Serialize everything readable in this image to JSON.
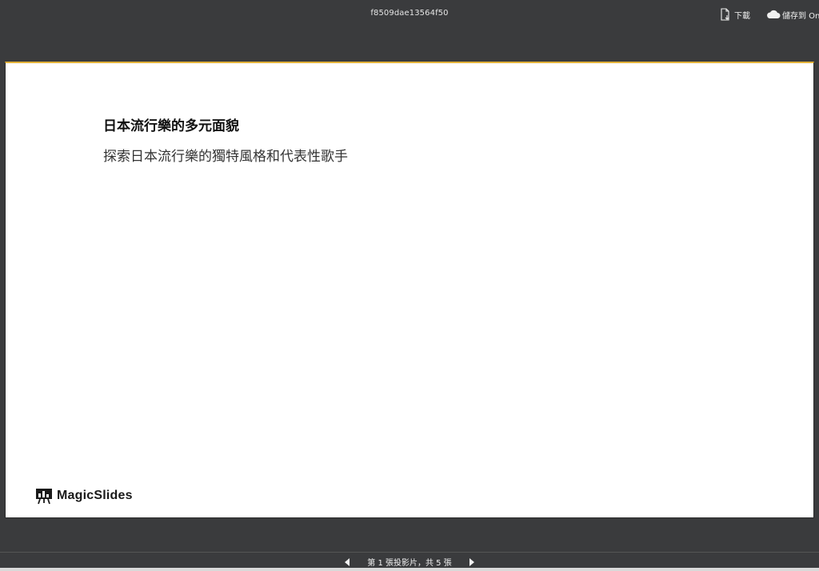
{
  "window": {
    "title": "f8509dae13564f50"
  },
  "toolbar": {
    "download_label": "下載",
    "save_label": "儲存到 OneDrive"
  },
  "slide": {
    "title": "日本流行樂的多元面貌",
    "subtitle": "探索日本流行樂的獨特風格和代表性歌手",
    "brand": "MagicSlides"
  },
  "pager": {
    "label": "第 1 張投影片，共 5 張"
  },
  "colors": {
    "accent": "#e2b23a",
    "chrome": "#3a3b3d"
  },
  "icons": {
    "download": "download-file-icon",
    "save": "cloud-icon",
    "prev": "triangle-left-icon",
    "next": "triangle-right-icon"
  }
}
